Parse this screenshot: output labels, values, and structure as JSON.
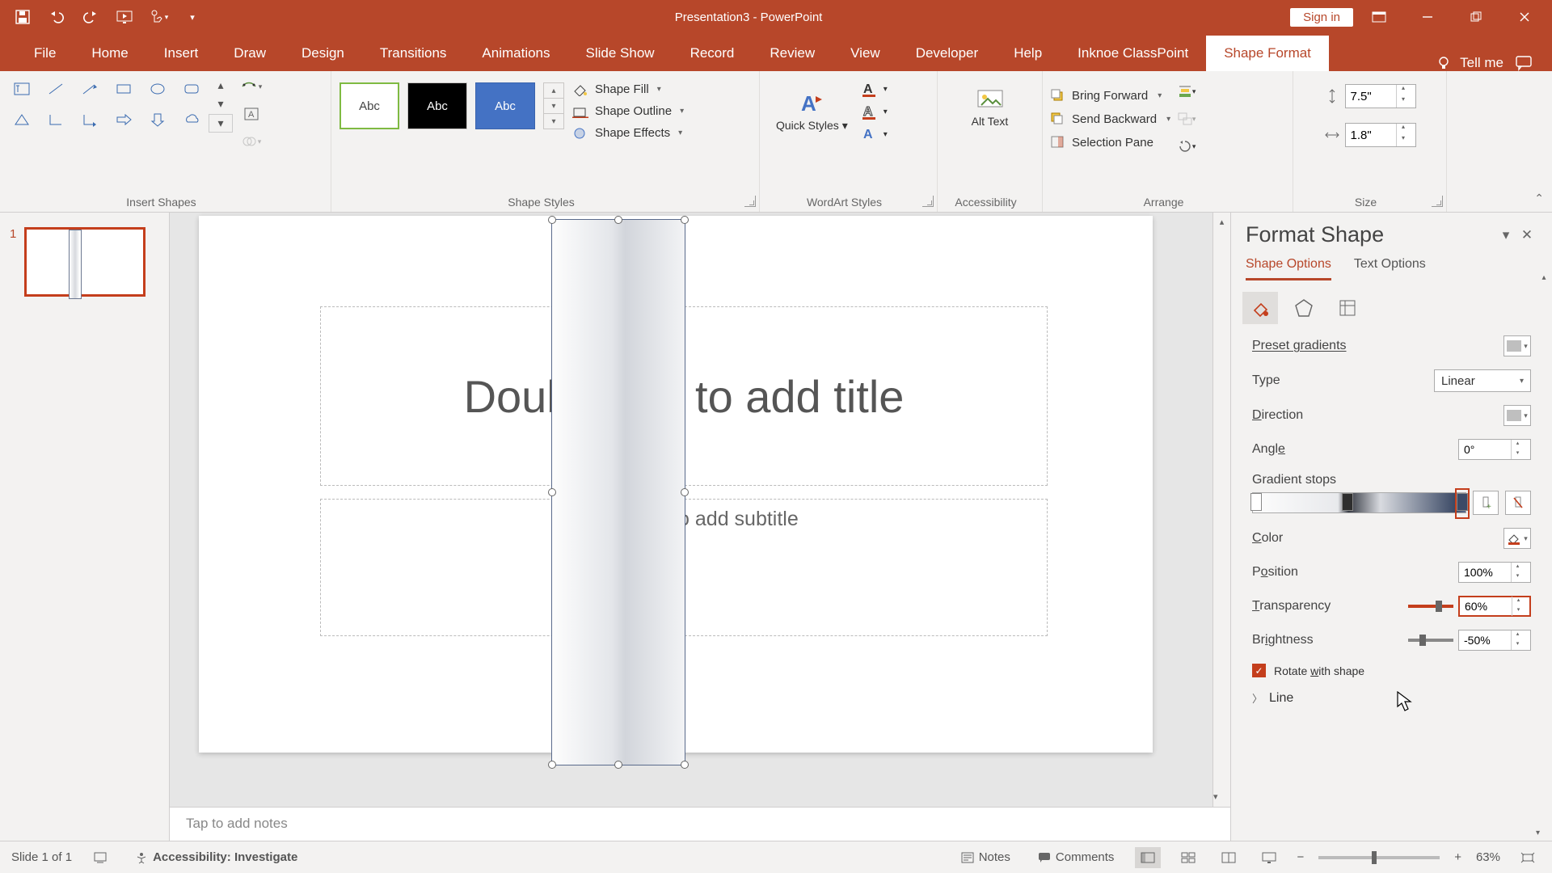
{
  "app": {
    "title": "Presentation3  -  PowerPoint",
    "signin": "Sign in"
  },
  "tabs": {
    "file": "File",
    "home": "Home",
    "insert": "Insert",
    "draw": "Draw",
    "design": "Design",
    "transitions": "Transitions",
    "animations": "Animations",
    "slideshow": "Slide Show",
    "record": "Record",
    "review": "Review",
    "view": "View",
    "developer": "Developer",
    "help": "Help",
    "classpoint": "Inknoe ClassPoint",
    "shapeformat": "Shape Format",
    "tellme": "Tell me"
  },
  "ribbon": {
    "groups": {
      "insert_shapes": "Insert Shapes",
      "shape_styles": "Shape Styles",
      "wordart_styles": "WordArt Styles",
      "accessibility": "Accessibility",
      "arrange": "Arrange",
      "size": "Size"
    },
    "style_label": "Abc",
    "shape_fill": "Shape Fill",
    "shape_outline": "Shape Outline",
    "shape_effects": "Shape Effects",
    "quick_styles": "Quick Styles",
    "alt_text": "Alt Text",
    "bring_forward": "Bring Forward",
    "send_backward": "Send Backward",
    "selection_pane": "Selection Pane",
    "size_height": "7.5\"",
    "size_width": "1.8\""
  },
  "slide": {
    "number": "1",
    "title_placeholder": "Double tap to add title",
    "subtitle_placeholder": "Double tap to add subtitle",
    "notes_placeholder": "Tap to add notes"
  },
  "pane": {
    "title": "Format Shape",
    "tab_shape": "Shape Options",
    "tab_text": "Text Options",
    "preset_gradients": "Preset gradients",
    "type_label": "Type",
    "type_value": "Linear",
    "direction": "Direction",
    "angle_label": "Angle",
    "angle_value": "0°",
    "gradient_stops": "Gradient stops",
    "color": "Color",
    "position_label": "Position",
    "position_value": "100%",
    "transparency_label": "Transparency",
    "transparency_value": "60%",
    "brightness_label": "Brightness",
    "brightness_value": "-50%",
    "rotate": "Rotate with shape",
    "line": "Line"
  },
  "status": {
    "slide_of": "Slide 1 of 1",
    "accessibility": "Accessibility: Investigate",
    "notes": "Notes",
    "comments": "Comments",
    "zoom": "63%"
  }
}
